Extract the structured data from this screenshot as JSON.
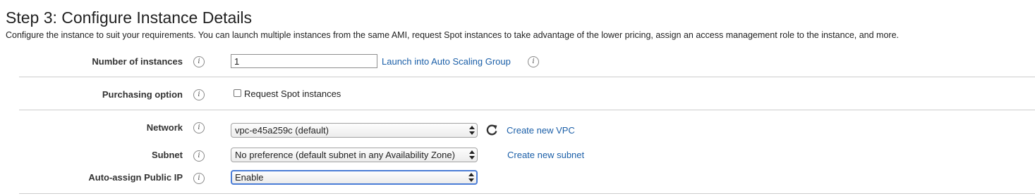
{
  "header": {
    "title": "Step 3: Configure Instance Details",
    "description": "Configure the instance to suit your requirements. You can launch multiple instances from the same AMI, request Spot instances to take advantage of the lower pricing, assign an access management role to the instance, and more."
  },
  "instances": {
    "label": "Number of instances",
    "value": "1",
    "link": "Launch into Auto Scaling Group"
  },
  "purchasing": {
    "label": "Purchasing option",
    "checkbox_label": "Request Spot instances",
    "checked": false
  },
  "network": {
    "label": "Network",
    "selected": "vpc-e45a259c (default)",
    "create_link": "Create new VPC"
  },
  "subnet": {
    "label": "Subnet",
    "selected": "No preference (default subnet in any Availability Zone)",
    "create_link": "Create new subnet"
  },
  "public_ip": {
    "label": "Auto-assign Public IP",
    "selected": "Enable"
  },
  "icons": {
    "info": "i",
    "info_name": "info-icon",
    "refresh_name": "refresh-icon"
  },
  "colors": {
    "link": "#1b5fa8",
    "focus": "#4a7cd6",
    "divider": "#cccccc"
  }
}
